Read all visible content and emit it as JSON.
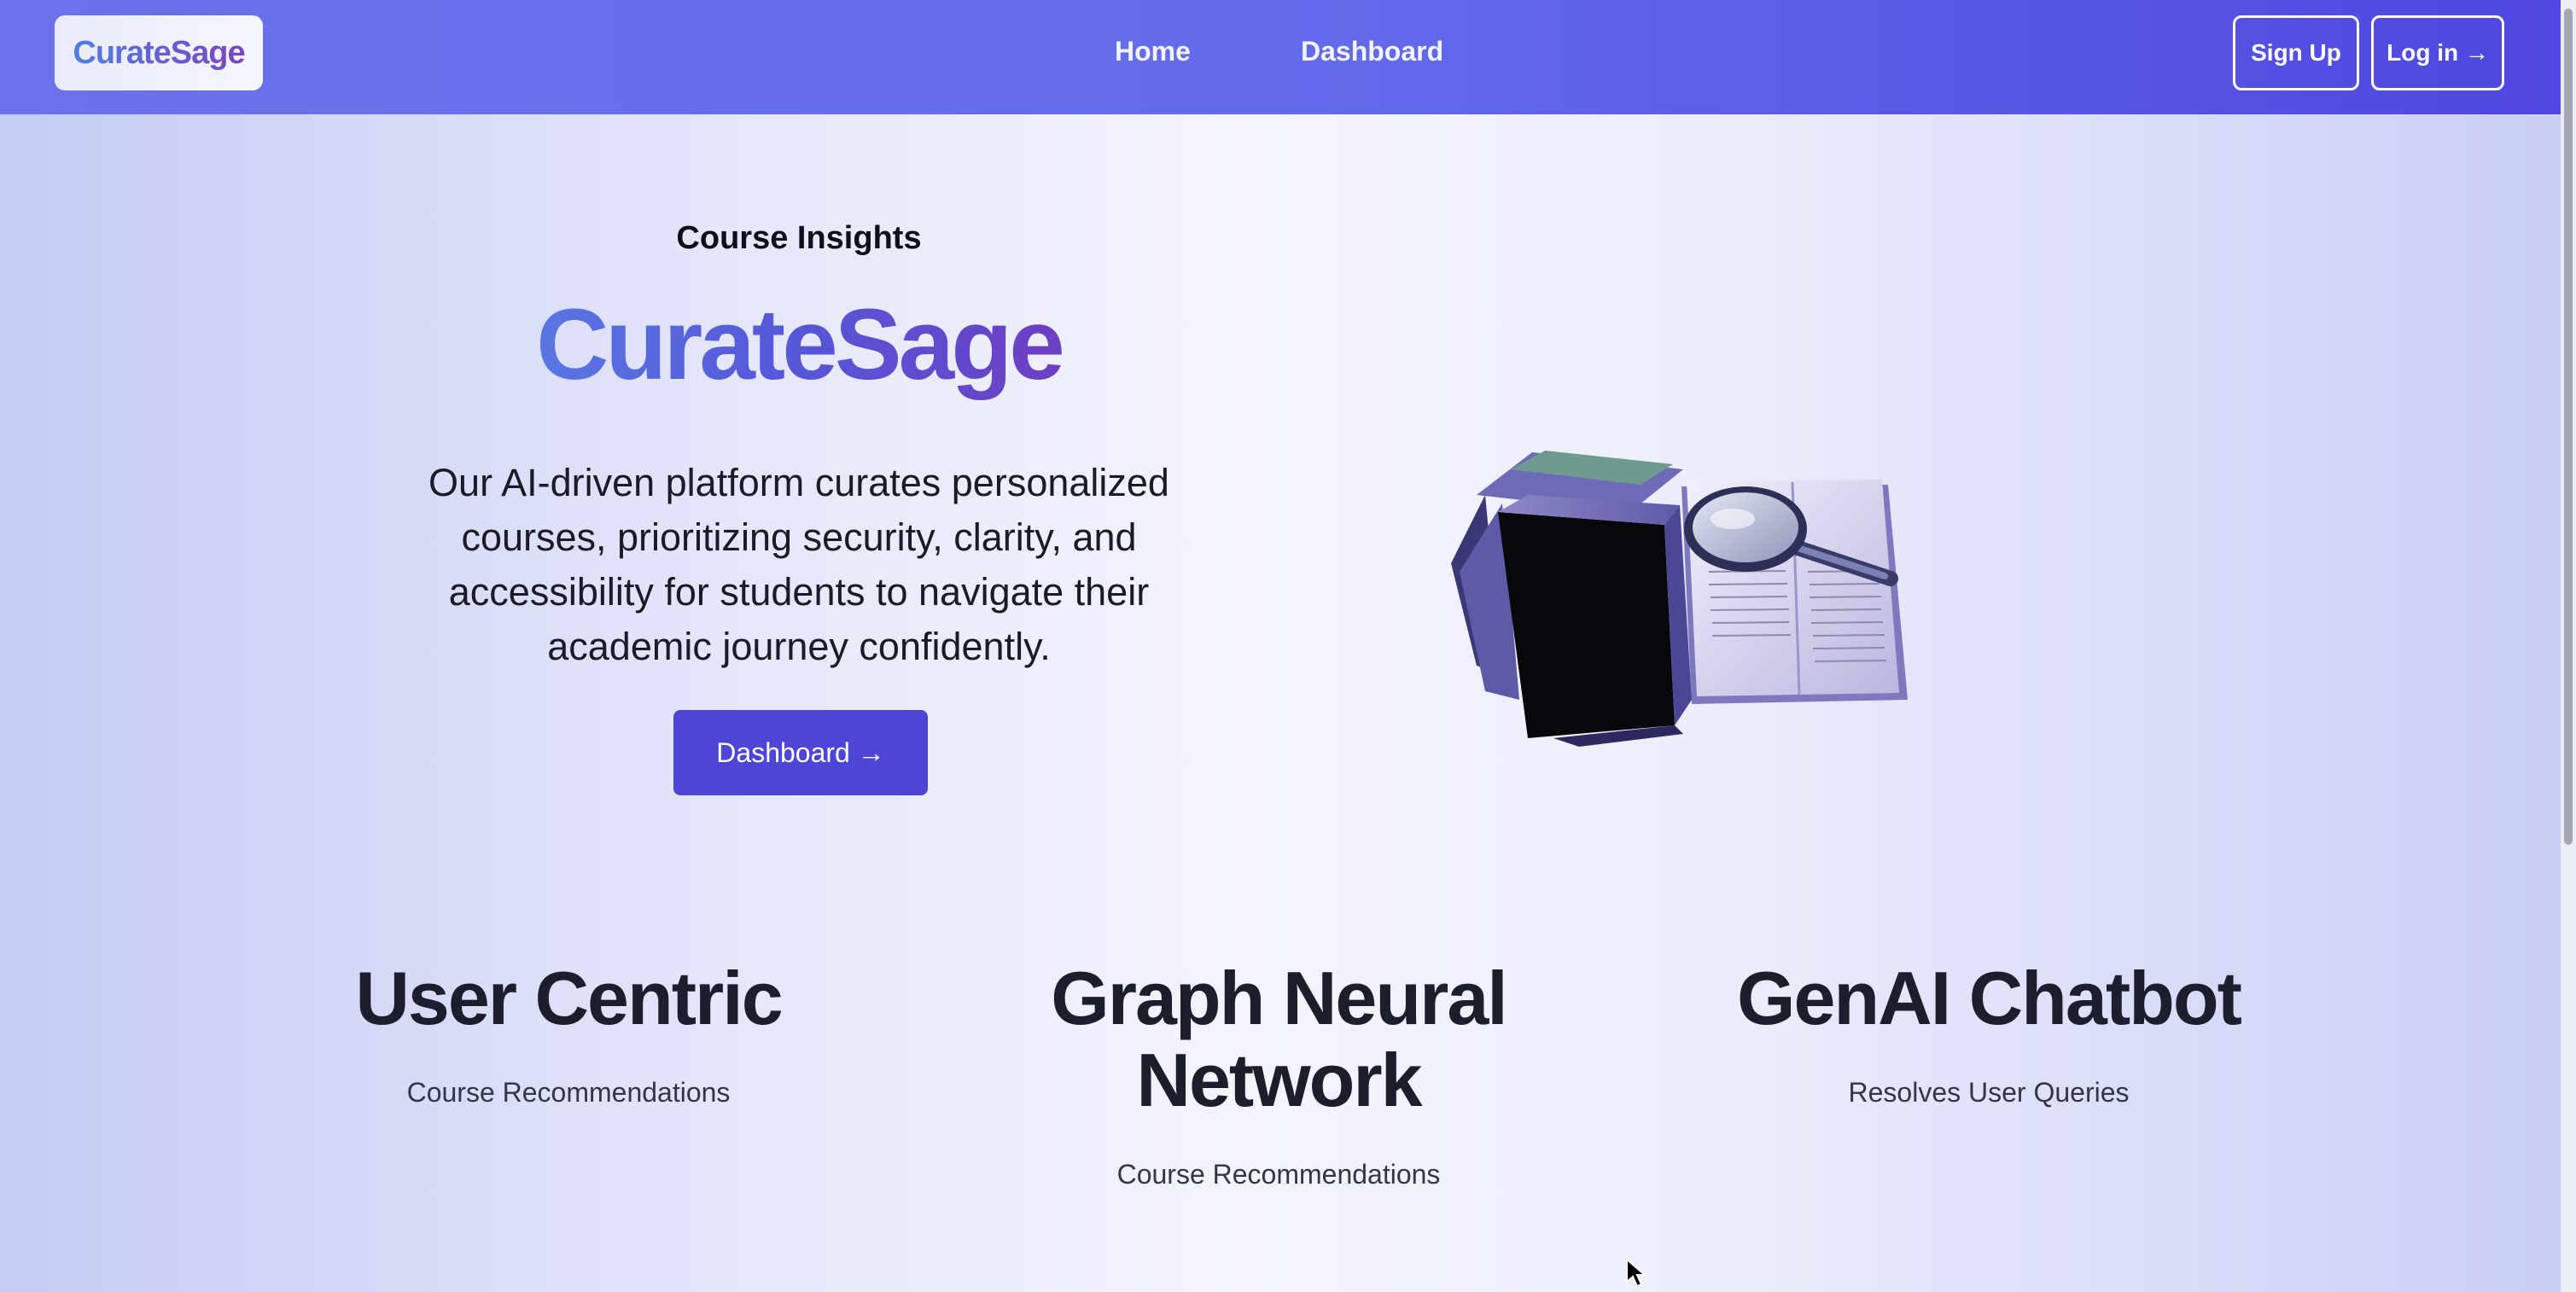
{
  "nav": {
    "logo": "CurateSage",
    "links": [
      "Home",
      "Dashboard"
    ],
    "signup_label": "Sign Up",
    "login_label": "Log in →"
  },
  "hero": {
    "eyebrow": "Course Insights",
    "title": "CurateSage",
    "description": "Our AI-driven platform curates personalized courses, prioritizing security, clarity, and accessibility for students to navigate their academic journey confidently.",
    "cta_label": "Dashboard →",
    "illustration_icon": "books-magnifier-icon"
  },
  "features": [
    {
      "title": "User Centric",
      "subtitle": "Course Recommendations"
    },
    {
      "title": "Graph Neural Network",
      "subtitle": "Course Recommendations"
    },
    {
      "title": "GenAI Chatbot",
      "subtitle": "Resolves User Queries"
    }
  ],
  "colors": {
    "nav_bg": "#636ceb",
    "cta_bg": "#4c45d8",
    "brand_gradient_start": "#5a76e2",
    "brand_gradient_end": "#6d3fc4"
  }
}
